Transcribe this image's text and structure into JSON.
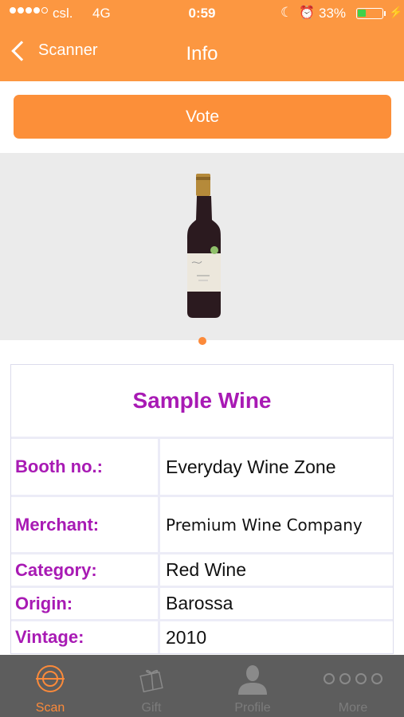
{
  "status_bar": {
    "carrier": "csl.",
    "network": "4G",
    "time": "0:59",
    "battery_percent": "33%",
    "signal_bars_filled": 4,
    "signal_bars_total": 5,
    "battery_level": 0.33,
    "icons": [
      "moon-icon",
      "alarm-icon",
      "battery-icon",
      "charging-bolt-icon"
    ]
  },
  "nav": {
    "back_label": "Scanner",
    "title": "Info"
  },
  "vote_button": {
    "label": "Vote"
  },
  "carousel": {
    "page_count": 1,
    "current_page": 1
  },
  "wine": {
    "name": "Sample Wine",
    "fields": [
      {
        "label": "Booth no.:",
        "value": "Everyday Wine Zone"
      },
      {
        "label": "Merchant:",
        "value": "Premium Wine Company"
      },
      {
        "label": "Category:",
        "value": "Red Wine"
      },
      {
        "label": "Origin:",
        "value": "Barossa"
      },
      {
        "label": "Vintage:",
        "value": "2010"
      }
    ]
  },
  "tabs": [
    {
      "label": "Scan",
      "icon": "scan-target-icon",
      "active": true
    },
    {
      "label": "Gift",
      "icon": "gift-icon",
      "active": false
    },
    {
      "label": "Profile",
      "icon": "person-icon",
      "active": false
    },
    {
      "label": "More",
      "icon": "more-dots-icon",
      "active": false
    }
  ],
  "colors": {
    "accent": "#fc9741",
    "button": "#fc8f39",
    "label_purple": "#a81ab4",
    "tab_bar": "#5d5d5d",
    "battery_green": "#3fd14a"
  }
}
